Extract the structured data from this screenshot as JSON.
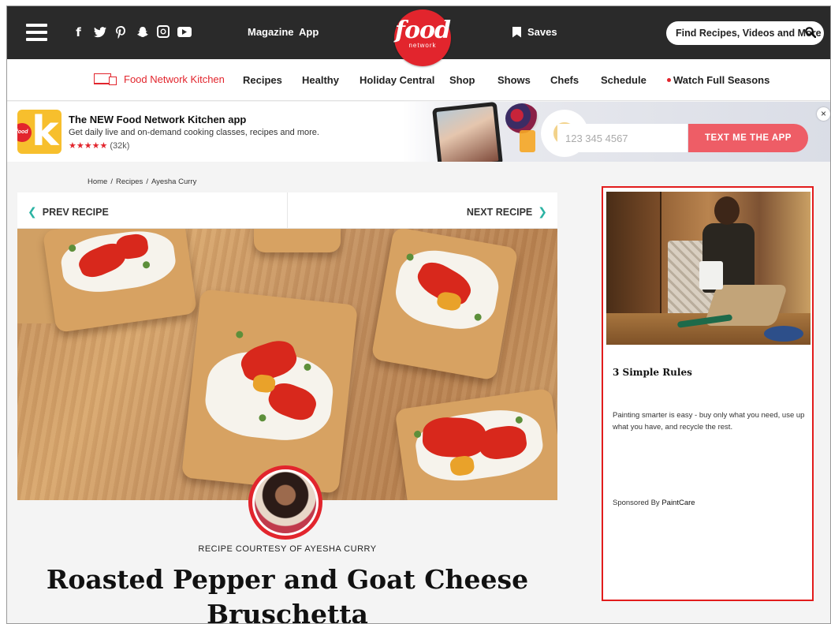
{
  "header": {
    "social_icons": [
      "facebook-icon",
      "twitter-icon",
      "pinterest-icon",
      "snapchat-icon",
      "instagram-icon",
      "youtube-icon"
    ],
    "links": {
      "magazine": "Magazine",
      "app": "App",
      "saves": "Saves"
    },
    "logo": {
      "main": "food",
      "sub": "network"
    },
    "search_placeholder": "Find Recipes, Videos and More"
  },
  "subnav": {
    "items": [
      "Food Network Kitchen",
      "Recipes",
      "Healthy",
      "Holiday Central",
      "Shop",
      "Shows",
      "Chefs",
      "Schedule",
      "Watch Full Seasons"
    ]
  },
  "promo": {
    "title": "The NEW Food Network Kitchen app",
    "description": "Get daily live and on-demand cooking classes, recipes and more.",
    "stars": "★★★★★",
    "rating_count": "(32k)",
    "phone_placeholder": "123 345 4567",
    "button": "TEXT ME THE APP",
    "close": "×"
  },
  "breadcrumb": [
    "Home",
    "Recipes",
    "Ayesha Curry"
  ],
  "recipe_nav": {
    "prev": "PREV RECIPE",
    "next": "NEXT RECIPE"
  },
  "recipe": {
    "courtesy": "RECIPE COURTESY OF AYESHA CURRY",
    "title": "Roasted Pepper and Goat Cheese Bruschetta"
  },
  "ad": {
    "heading": "3 Simple Rules",
    "body": "Painting smarter is easy - buy only what you need, use up what you have, and recycle the rest.",
    "sponsor_prefix": "Sponsored By ",
    "sponsor": "PaintCare"
  },
  "colors": {
    "brand_red": "#e2252d",
    "accent_teal": "#2bb3a3",
    "ad_border": "#e21c1c",
    "cta_pink": "#ee5d66"
  }
}
